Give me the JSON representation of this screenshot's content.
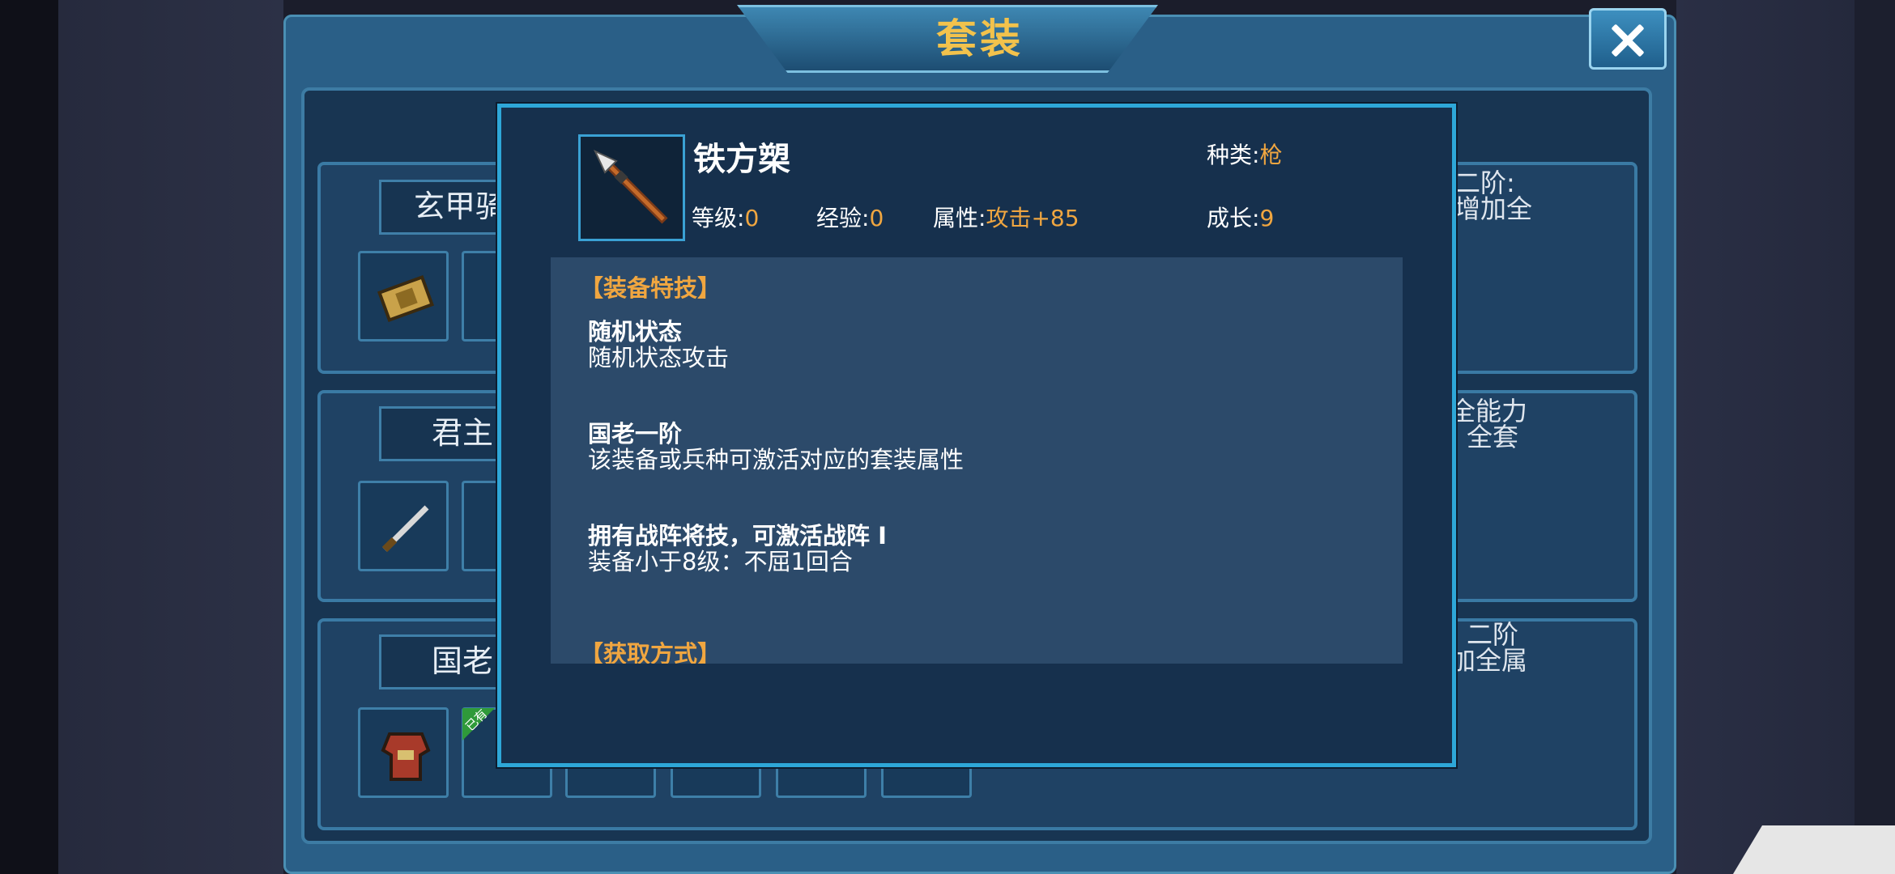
{
  "panel": {
    "title": "套装",
    "close_icon": "close-x-icon"
  },
  "sets": [
    {
      "name": "玄甲骑",
      "side_lines": [
        "二阶:",
        "增加全"
      ]
    },
    {
      "name": "君主",
      "side_lines": [
        "全能力",
        ": 全套"
      ]
    },
    {
      "name": "国老",
      "side_lines": [
        "; 二阶",
        "加全属"
      ]
    }
  ],
  "owned_tag": "已有",
  "item": {
    "name": "铁方槊",
    "icon": "spear-icon",
    "type_label": "种类:",
    "type_value": "枪",
    "level_label": "等级:",
    "level_value": "0",
    "exp_label": "经验:",
    "exp_value": "0",
    "attr_label": "属性:",
    "attr_value": "攻击+85",
    "growth_label": "成长:",
    "growth_value": "9"
  },
  "description": {
    "skill_header": "【装备特技】",
    "skills": [
      {
        "title": "随机状态",
        "desc": "随机状态攻击"
      },
      {
        "title": "国老一阶",
        "desc": "该装备或兵种可激活对应的套装属性"
      },
      {
        "title": "拥有战阵将技，可激活战阵 I",
        "desc": "装备小于8级：不屈1回合"
      }
    ],
    "source_header": "【获取方式】"
  },
  "colors": {
    "accent_gold": "#f0a640",
    "popup_border": "#2ea7d8",
    "panel_blue": "#2a5f87"
  }
}
